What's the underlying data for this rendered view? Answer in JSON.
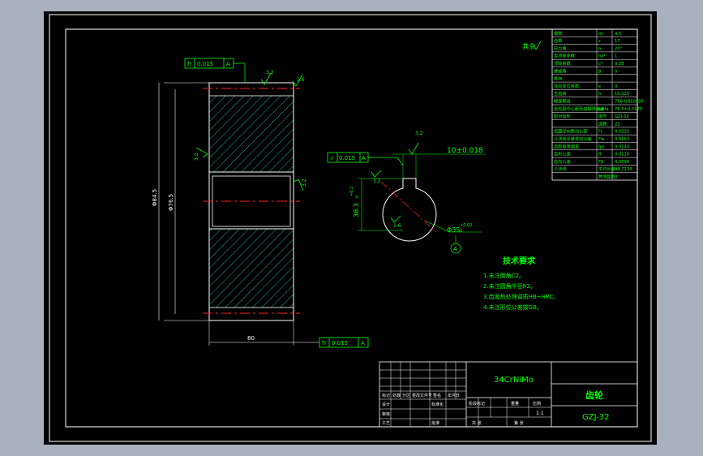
{
  "colors": {
    "background": "#000000",
    "frame": "#ffffff",
    "annotation": "#00ff00",
    "hatch": "#1fa8a8",
    "centerline": "#ff2020",
    "text_white": "#ffffff"
  },
  "surface_finish_note": "其余",
  "gear_front": {
    "tolerance_frame_top": {
      "symbol": "h",
      "value": "0.015",
      "datum": "A"
    },
    "tolerance_frame_bottom": {
      "symbol": "h",
      "value": "0.015",
      "datum": "A"
    },
    "roughness_top_1": "3.2",
    "roughness_top_2": "1.6",
    "roughness_left": "3.2",
    "roughness_bore": "3.2",
    "dim_outer_diameter": "Φ84.5",
    "dim_root_diameter": "Φ76.5",
    "dim_face_width": "80"
  },
  "gear_side": {
    "tolerance_frame": {
      "symbol": "⌭",
      "value": "0.015",
      "datum": "A"
    },
    "keyway_width": "10±0.018",
    "keyway_depth": "38.3",
    "keyway_depth_tol": "+0.2",
    "keyway_depth_tol_low": "0",
    "bore_diameter": "Φ35",
    "bore_tol_high": "+0.02",
    "bore_tol_low": "0",
    "roughness_key": "3.2",
    "roughness_bore": "1.6",
    "roughness_small": "3.2",
    "datum_label": "A"
  },
  "tech_requirements": {
    "title": "技术要求",
    "items": [
      "1.未注倒角C2。",
      "2.未注圆角半径R2。",
      "3.齿面热处理调质HB~HRC。",
      "4.未注形位公差按GB。"
    ]
  },
  "param_table": {
    "rows": [
      [
        "模数",
        "m",
        "4.5"
      ],
      [
        "齿数",
        "z",
        "17"
      ],
      [
        "压力角",
        "α",
        "20°"
      ],
      [
        "齿顶高系数",
        "ha*",
        "1"
      ],
      [
        "顶隙系数",
        "c*",
        "0.25"
      ],
      [
        "螺旋角",
        "β",
        "0"
      ],
      [
        "旋向",
        "",
        ""
      ],
      [
        "径向变位系数",
        "x",
        "0"
      ],
      [
        "全齿高",
        "h",
        "10.125"
      ],
      [
        "精度等级",
        "",
        "766 GB10095"
      ],
      [
        "齿轮副中心距及其极限偏差",
        "a±fa",
        "76.5±0.0175"
      ],
      [
        "配对齿轮",
        "图号",
        "GZJ-32"
      ],
      [
        "",
        "齿数",
        "22"
      ],
      [
        "齿圈径向跳动公差",
        "Fr",
        "0.0320"
      ],
      [
        "公法线长度变动公差",
        "Fw",
        "0.0162"
      ],
      [
        "齿距极限偏差",
        "fpt",
        "0.0140"
      ],
      [
        "齿形公差",
        "ff",
        "0.0110"
      ],
      [
        "齿向公差",
        "Fβ",
        "0.0090"
      ],
      [
        "公法线",
        "平均长度",
        "48.7234"
      ],
      [
        "",
        "跨测齿数",
        "3"
      ]
    ]
  },
  "title_block": {
    "material": "34CrNiMo",
    "part_name": "齿轮",
    "drawing_no": "GZJ-32",
    "scale": "1:1",
    "labels": {
      "mark": "标记",
      "count": "处数",
      "zone": "分区",
      "change_doc": "更改文件号",
      "sign": "签名",
      "date": "年月日",
      "design": "设计",
      "standardize": "标准化",
      "stage": "阶段标记",
      "weight": "重量",
      "ratio": "比例",
      "review": "审核",
      "process": "工艺",
      "approve": "批准",
      "total": "共 张",
      "sheet": "第 张"
    }
  }
}
